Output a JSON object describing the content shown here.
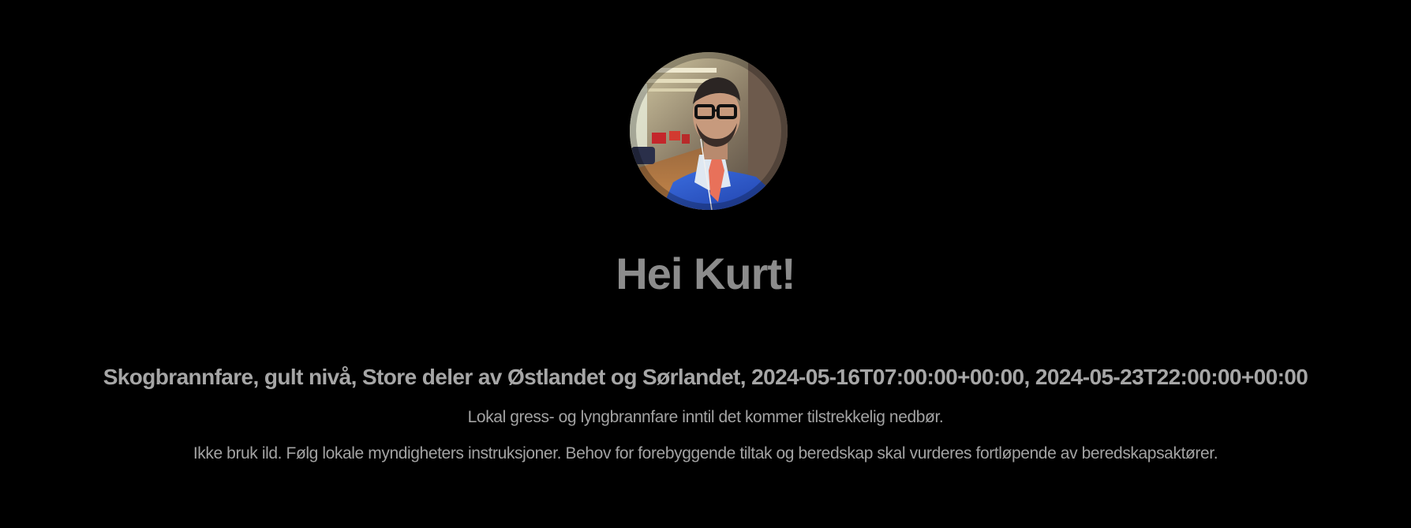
{
  "profile": {
    "avatar_icon": "user-photo-avatar",
    "greeting": "Hei Kurt!"
  },
  "alert": {
    "title": "Skogbrannfare, gult nivå, Store deler av Østlandet og Sørlandet, 2024-05-16T07:00:00+00:00, 2024-05-23T22:00:00+00:00",
    "description": "Lokal gress- og lyngbrannfare inntil det kommer tilstrekkelig nedbør.",
    "instruction": "Ikke bruk ild. Følg lokale myndigheters instruksjoner. Behov for forebyggende tiltak og beredskap skal vurderes fortløpende av beredskapsaktører."
  },
  "colors": {
    "background": "#000000",
    "greeting_text": "#8c8c8c",
    "alert_text": "#a6a6a6"
  }
}
